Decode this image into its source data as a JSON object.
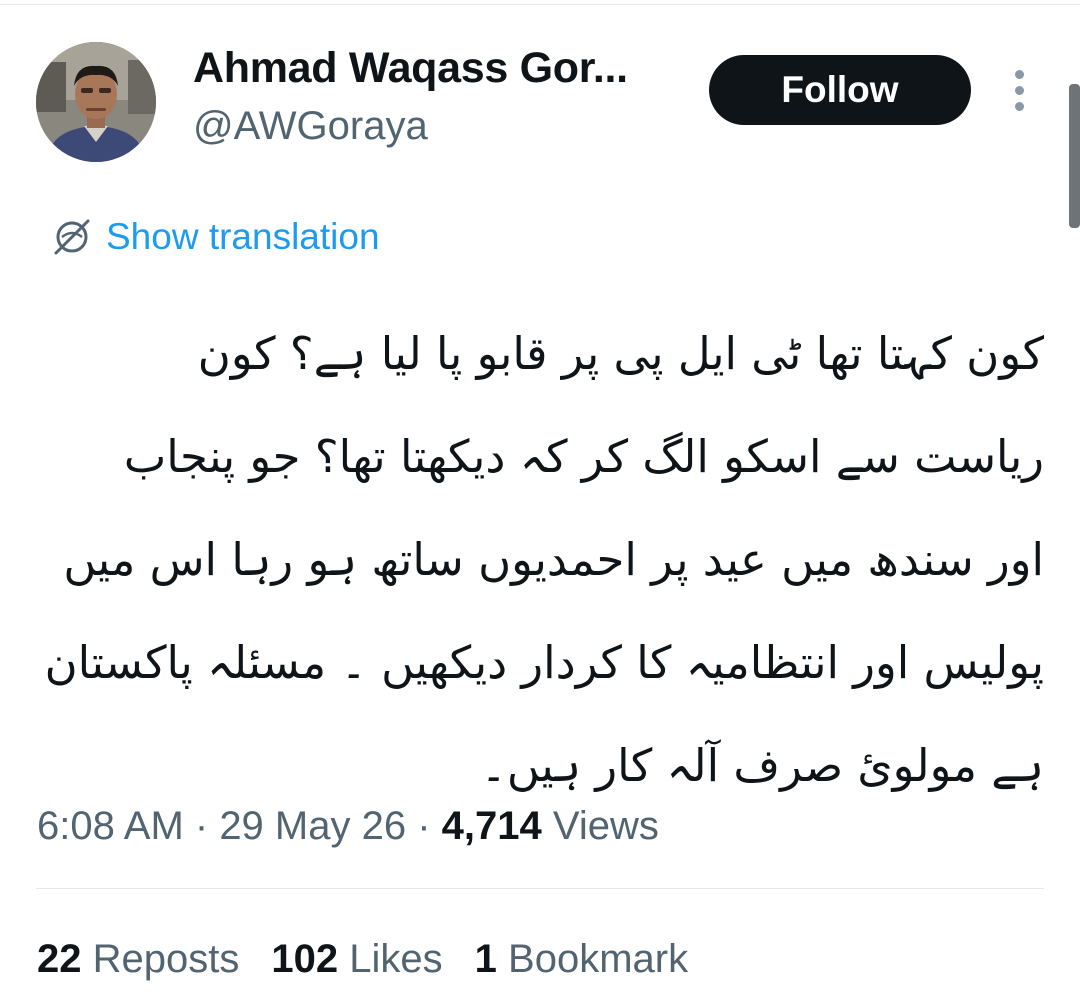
{
  "author": {
    "display_name": "Ahmad Waqass Gor...",
    "handle": "@AWGoraya"
  },
  "follow_button": {
    "label": "Follow"
  },
  "more_button": {
    "icon": "vertical-ellipsis-icon"
  },
  "translation": {
    "icon": "globe-slash-icon",
    "label": "Show translation"
  },
  "tweet": {
    "lines": [
      "کون کہتا تھا ٹی ایل پی پر قابو پا لیا ہے؟  کون",
      "ریاست سے اسکو الگ کر کہ دیکھتا تھا؟ جو پنجاب",
      "اور سندھ میں عید پر احمدیوں ساتھ ہو رہا اس میں",
      "پولیس اور انتظامیہ کا کردار دیکھیں ۔ مسئلہ پاکستان",
      "ہے مولوئ صرف آلہ کار ہیں۔"
    ]
  },
  "meta": {
    "time": "6:08 AM",
    "separator": " · ",
    "date": "29 May 26",
    "views_count": "4,714",
    "views_label": "Views"
  },
  "stats": {
    "reposts_count": "22",
    "reposts_label": "Reposts",
    "likes_count": "102",
    "likes_label": "Likes",
    "bookmarks_count": "1",
    "bookmarks_label": "Bookmark"
  },
  "colors": {
    "link": "#1d9bf0",
    "secondary_text": "#536471",
    "primary_text": "#0f1419",
    "follow_bg": "#0f1419"
  }
}
